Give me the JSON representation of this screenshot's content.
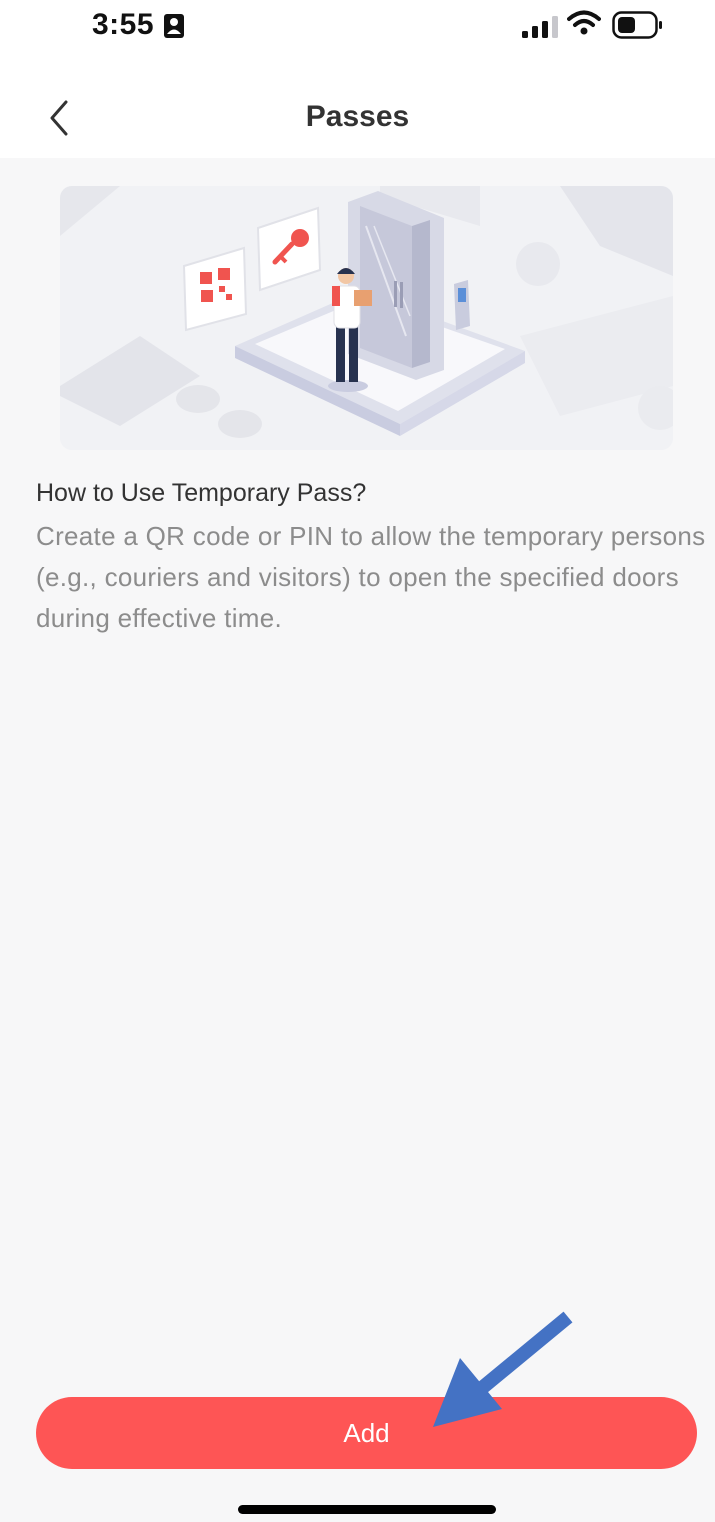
{
  "status_bar": {
    "time": "3:55",
    "icons": [
      "contact-card-icon",
      "cellular-signal-icon",
      "wifi-icon",
      "battery-icon"
    ]
  },
  "header": {
    "title": "Passes",
    "back_icon": "chevron-left-icon"
  },
  "hero_illustration": {
    "depicts": [
      "qr-code-icon",
      "key-icon",
      "courier-figure",
      "door",
      "access-panel"
    ]
  },
  "help": {
    "title": "How to Use Temporary Pass?",
    "body": "Create a QR code or PIN to allow the temporary persons (e.g., couriers and visitors) to open the specified doors during effective time."
  },
  "actions": {
    "add_label": "Add"
  },
  "colors": {
    "accent": "#fe5555",
    "page_background": "#f7f7f8",
    "title_text": "#333333",
    "body_text": "#8c8c8c",
    "annotation_arrow": "#4472c4"
  }
}
